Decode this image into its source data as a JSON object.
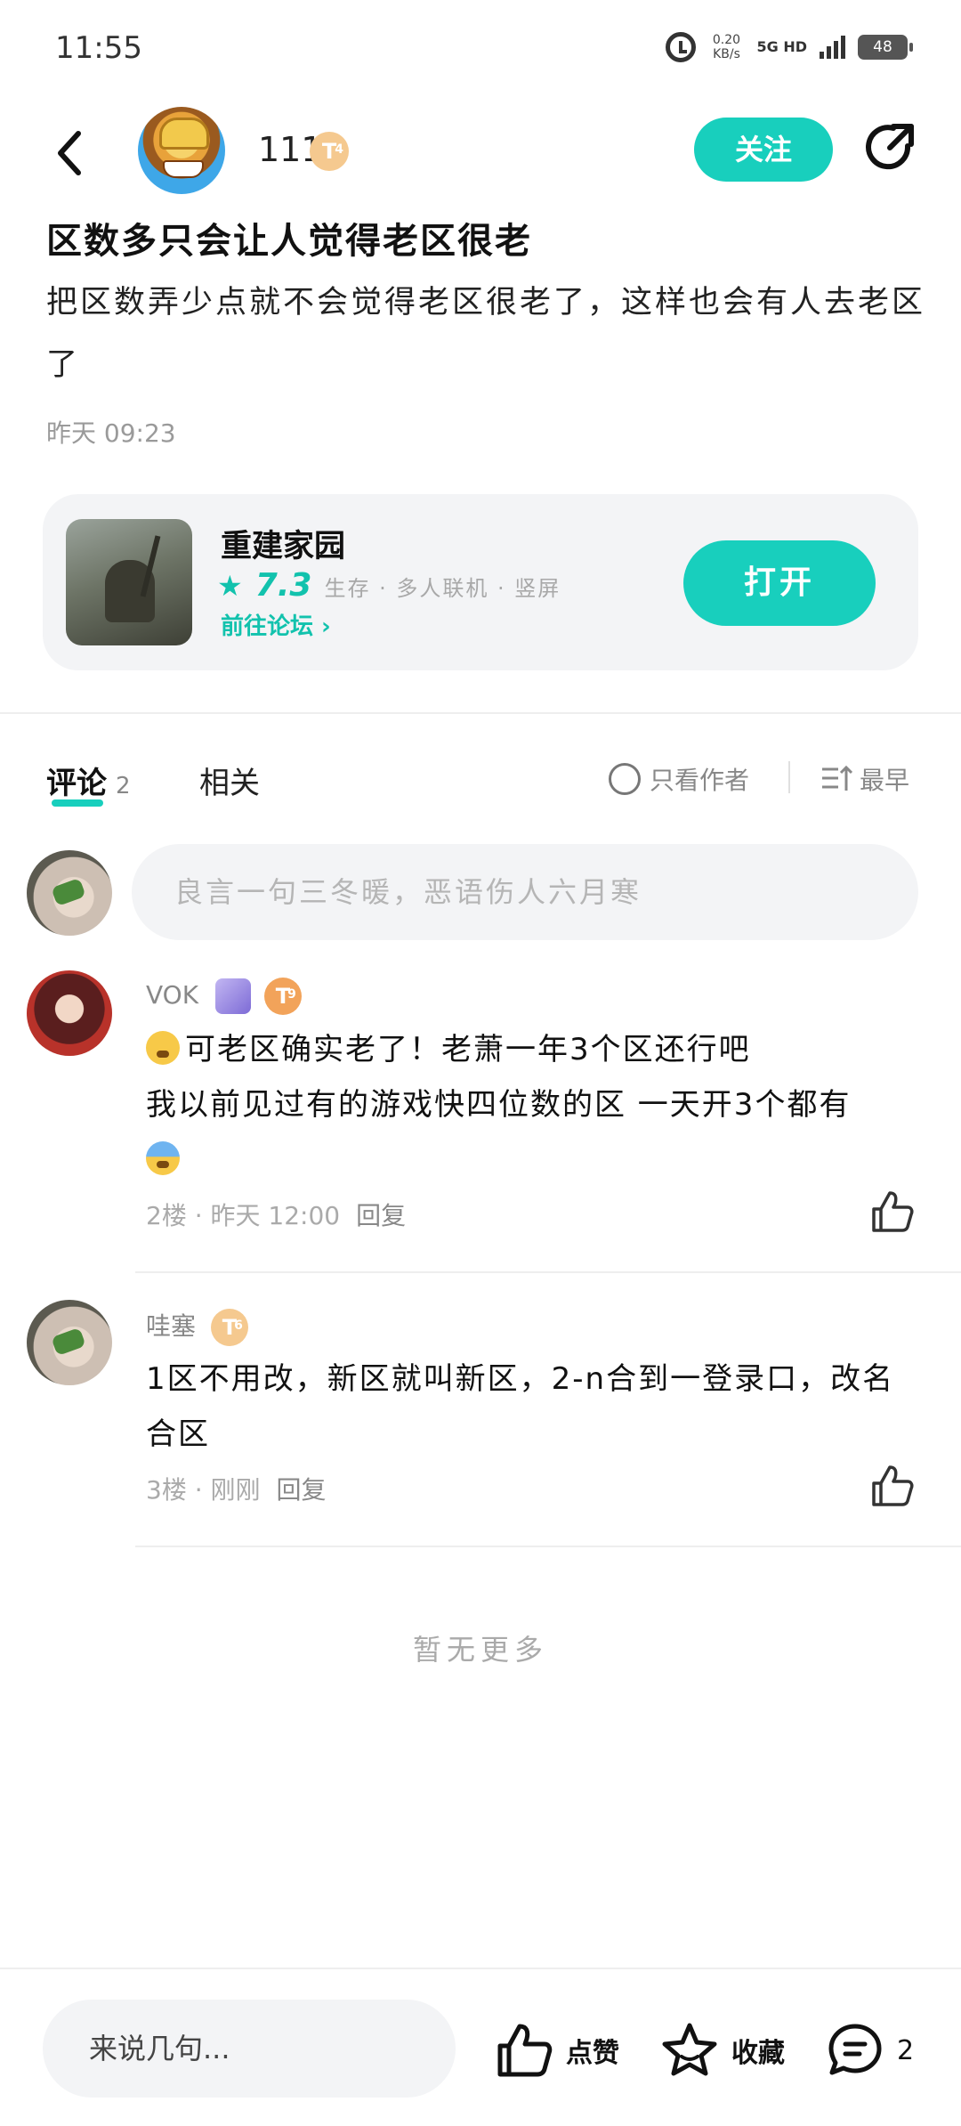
{
  "status_bar": {
    "time": "11:55",
    "net_speed": "0.20",
    "net_speed_unit": "KB/s",
    "network": "5G HD",
    "battery": "48"
  },
  "header": {
    "author_name": "111",
    "author_level": "T",
    "author_level_num": "4",
    "follow_label": "关注",
    "icons": [
      "chevron-left-icon",
      "share-icon"
    ]
  },
  "post": {
    "title": "区数多只会让人觉得老区很老",
    "body": "把区数弄少点就不会觉得老区很老了，这样也会有人去老区了",
    "time": "昨天 09:23"
  },
  "game_card": {
    "name": "重建家园",
    "score": "7.3",
    "tags": "生存 · 多人联机 · 竖屏",
    "forum_link": "前往论坛 ›",
    "open_label": "打开"
  },
  "tabs": {
    "comments_label": "评论",
    "comments_count": "2",
    "related_label": "相关",
    "author_only_label": "只看作者",
    "sort_label": "最早"
  },
  "comment_input": {
    "placeholder": "良言一句三冬暖，恶语伤人六月寒"
  },
  "comments": [
    {
      "name": "VOK",
      "level": "T",
      "level_num": "9",
      "line1": "可老区确实老了！老萧一年3个区还行吧",
      "line2": "我以前见过有的游戏快四位数的区 一天开3个都有",
      "floor_time": "2楼 · 昨天 12:00",
      "reply_label": "回复"
    },
    {
      "name": "哇塞",
      "level": "T",
      "level_num": "6",
      "text": "1区不用改，新区就叫新区，2-n合到一登录口，改名合区",
      "floor_time": "3楼 · 刚刚",
      "reply_label": "回复"
    }
  ],
  "no_more": "暂无更多",
  "bottom_bar": {
    "input_placeholder": "来说几句...",
    "like_label": "点赞",
    "fav_label": "收藏",
    "comment_count": "2"
  },
  "colors": {
    "accent": "#18cfbd",
    "badge": "#f5c98f",
    "muted": "#9a9a9a"
  }
}
